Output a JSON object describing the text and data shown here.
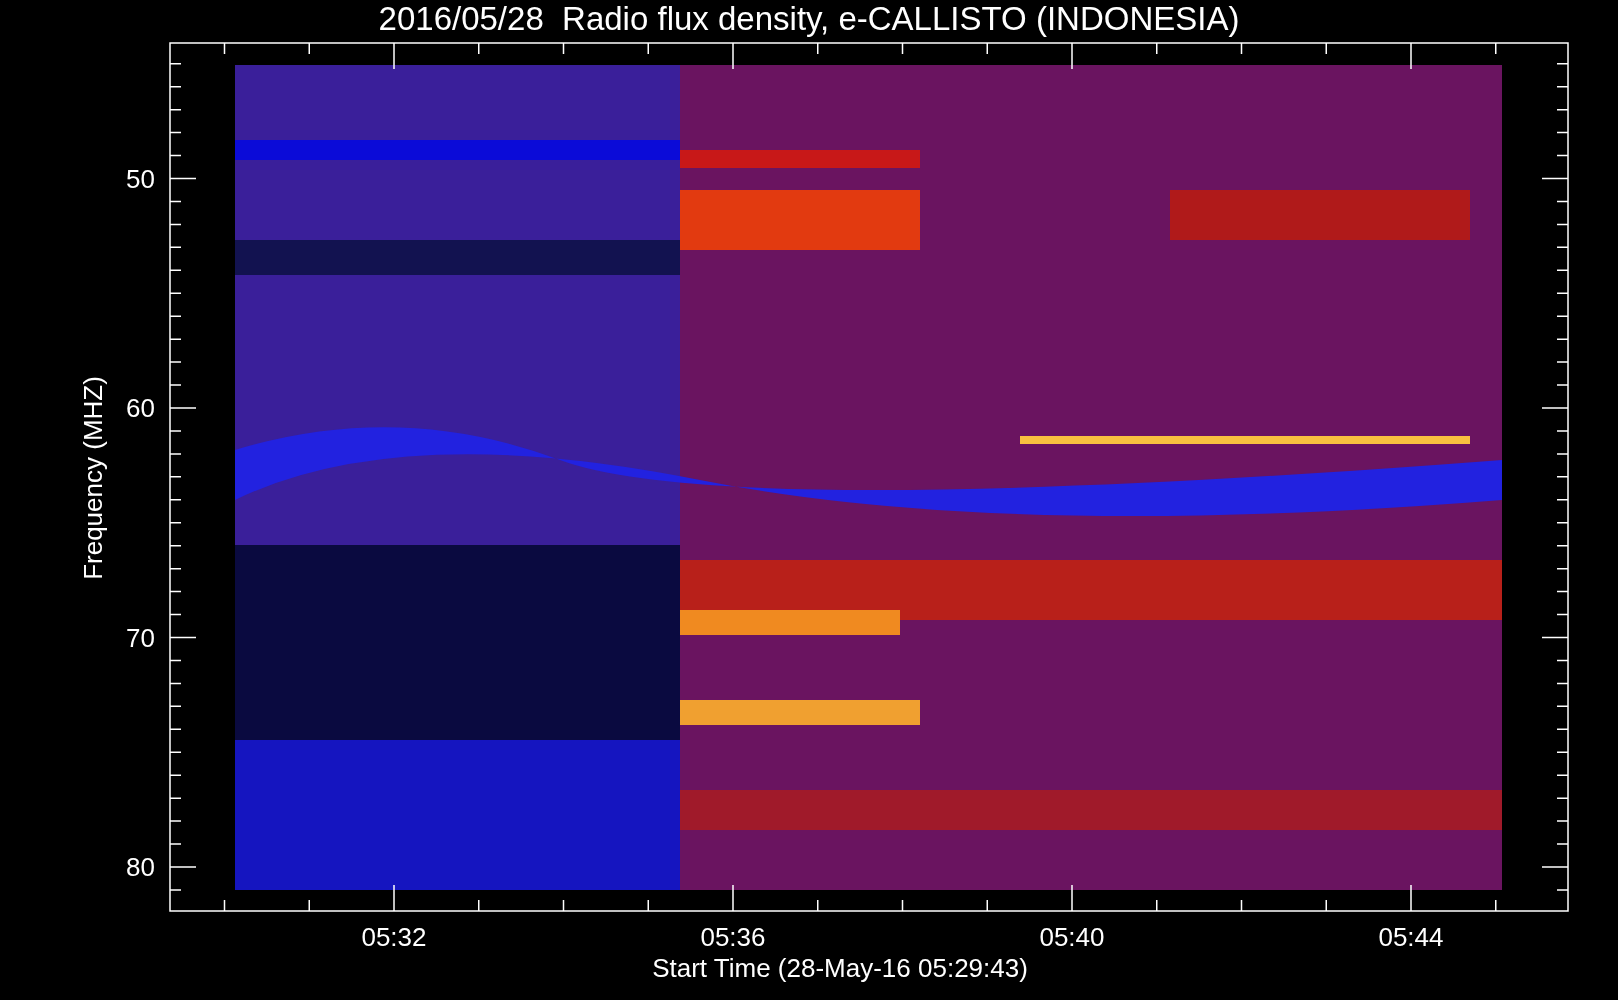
{
  "title": "2016/05/28  Radio flux density, e-CALLISTO (INDONESIA)",
  "y_axis": {
    "label": "Frequency (MHZ)",
    "ticks": [
      "50",
      "60",
      "70",
      "80"
    ]
  },
  "x_axis": {
    "label": "Start Time (28-May-16 05:29:43)",
    "ticks": [
      "05:32",
      "05:36",
      "05:40",
      "05:44"
    ]
  }
}
